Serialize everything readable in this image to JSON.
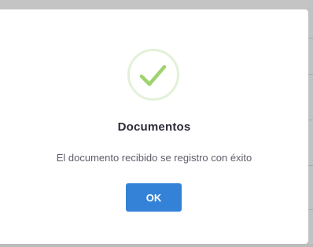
{
  "dialog": {
    "icon": "checkmark-icon",
    "title": "Documentos",
    "message": "El documento recibido se registro con éxito",
    "ok_label": "OK"
  },
  "colors": {
    "accent": "#3482d8",
    "success": "#9ed36e",
    "success_ring": "#e3f1d8"
  }
}
